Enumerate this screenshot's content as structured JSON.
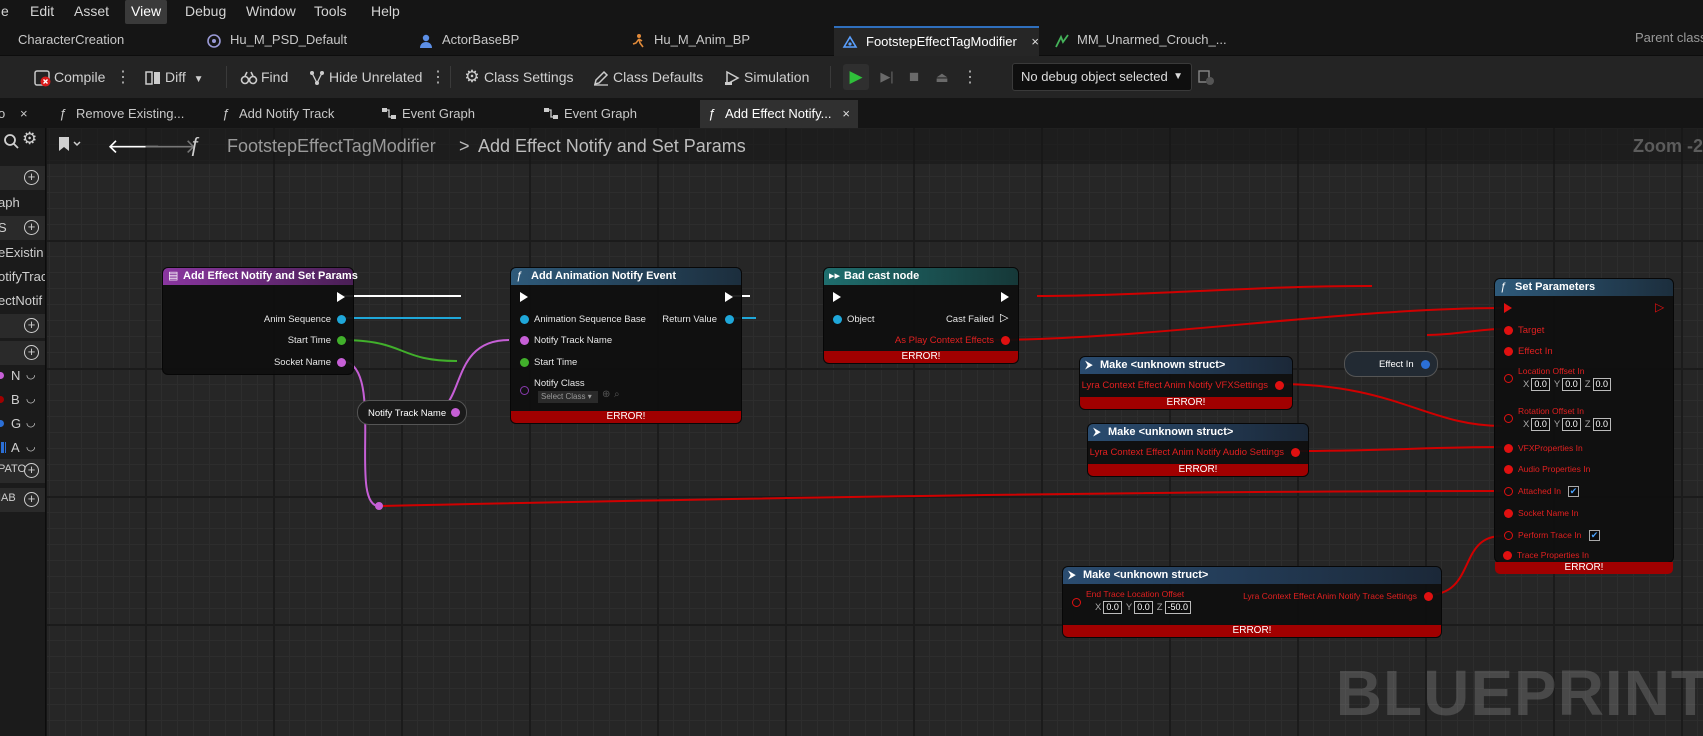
{
  "menu": {
    "items": [
      "e",
      "Edit",
      "Asset",
      "View",
      "Debug",
      "Window",
      "Tools",
      "Help"
    ],
    "active": "View"
  },
  "doc_tabs": {
    "tabs": [
      "CharacterCreation",
      "Hu_M_PSD_Default",
      "ActorBaseBP",
      "Hu_M_Anim_BP",
      "FootstepEffectTagModifier",
      "MM_Unarmed_Crouch_..."
    ],
    "active": "FootstepEffectTagModifier",
    "close": "×",
    "parent_class": "Parent class"
  },
  "toolbar": {
    "compile": "Compile",
    "diff": "Diff",
    "find": "Find",
    "hide_unrelated": "Hide Unrelated",
    "class_settings": "Class Settings",
    "class_defaults": "Class Defaults",
    "simulation": "Simulation",
    "debug_object": "No debug object selected"
  },
  "graph_tabs": {
    "tabs": [
      "Remove Existing...",
      "Add Notify Track",
      "Event Graph",
      "Event Graph",
      "Add Effect Notify..."
    ],
    "active": "Add Effect Notify..."
  },
  "left_panel": {
    "items": [
      "aph",
      "eExistin",
      "otifyTrac",
      "ectNotif"
    ],
    "sections": [
      "S",
      "PATO",
      "IAB"
    ],
    "vars": [
      {
        "label": "N",
        "color": "#c65fd6"
      },
      {
        "label": "B",
        "color": "#a00000"
      },
      {
        "label": "G",
        "color": "#2b6fd6"
      },
      {
        "label": "A",
        "color": "#2b6fd6"
      }
    ]
  },
  "breadcrumb": {
    "function": "FootstepEffectTagModifier",
    "separator": ">",
    "current": "Add Effect Notify and Set Params"
  },
  "zoom": "Zoom -2",
  "watermark": "BLUEPRINT",
  "error_label": "ERROR!",
  "nodes": {
    "entry": {
      "title": "Add Effect Notify and Set Params",
      "pins": [
        "Anim Sequence",
        "Start Time",
        "Socket Name"
      ]
    },
    "notify_track_var": {
      "label": "Notify Track Name"
    },
    "add_anim_notify": {
      "title": "Add Animation Notify Event",
      "inputs": [
        "Animation Sequence Base",
        "Notify Track Name",
        "Start Time",
        "Notify Class"
      ],
      "select_class": "Select Class",
      "return": "Return Value"
    },
    "bad_cast": {
      "title": "Bad cast node",
      "object": "Object",
      "cast_failed": "Cast Failed",
      "as_play": "As Play Context Effects"
    },
    "effect_in_var": {
      "label": "Effect In"
    },
    "make_vfx": {
      "title": "Make <unknown struct>",
      "pin": "Lyra Context Effect Anim Notify VFXSettings"
    },
    "make_audio": {
      "title": "Make <unknown struct>",
      "pin": "Lyra Context Effect Anim Notify Audio Settings"
    },
    "make_trace": {
      "title": "Make <unknown struct>",
      "in_pin": "End Trace Location Offset",
      "x": "0.0",
      "y": "0.0",
      "z": "-50.0",
      "out_pin": "Lyra Context Effect Anim Notify Trace Settings"
    },
    "set_params": {
      "title": "Set Parameters",
      "target": "Target",
      "effect_in": "Effect In",
      "location_offset": "Location Offset In",
      "location": {
        "x": "0.0",
        "y": "0.0",
        "z": "0.0"
      },
      "rotation_offset": "Rotation Offset In",
      "rotation": {
        "x": "0.0",
        "y": "0.0",
        "z": "0.0"
      },
      "vfx": "VFXProperties In",
      "audio": "Audio Properties In",
      "attached": "Attached In",
      "socket": "Socket Name In",
      "perform_trace": "Perform Trace In",
      "trace": "Trace Properties In"
    }
  },
  "axis_letters": {
    "x": "X",
    "y": "Y",
    "z": "Z"
  },
  "colors": {
    "function_header": "#7a2a88",
    "function_header_blue": "#2e4b66",
    "cast_header": "#1e5b5b",
    "make_header": "#23405e",
    "wire_object": "#1fa7d9",
    "wire_float": "#41b02b",
    "wire_name": "#c65fd6",
    "wire_error": "#d00000",
    "error_bar": "#a10000"
  }
}
